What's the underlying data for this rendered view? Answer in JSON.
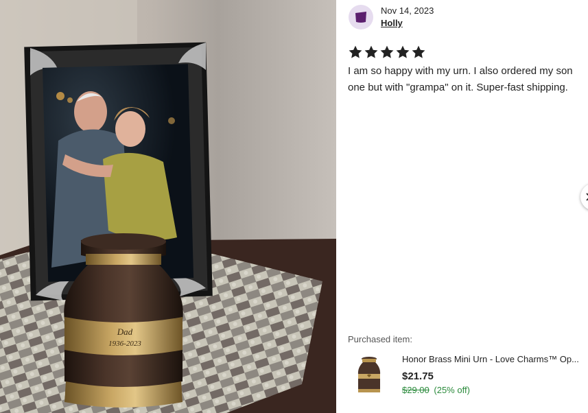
{
  "review": {
    "date": "Nov 14, 2023",
    "reviewer": "Holly",
    "rating": 5,
    "rating_max": 5,
    "text": "I am so happy with my urn. I also ordered my son one but with \"grampa\" on it. Super-fast shipping."
  },
  "purchased": {
    "label": "Purchased item:",
    "title": "Honor Brass Mini Urn - Love Charms™ Op...",
    "price": "$21.75",
    "original_price": "$29.00",
    "discount": "(25% off)"
  },
  "photo": {
    "engraving_line1": "Dad",
    "engraving_line2": "1936-2023"
  },
  "colors": {
    "avatar_bg": "#e6dcef",
    "avatar_icon": "#5b1f6e",
    "star": "#222222",
    "sale_green": "#2a8a3b"
  },
  "icons": {
    "avatar": "purple-shopping-bag-icon",
    "star": "star-icon",
    "carousel": "chevron-right-icon"
  }
}
